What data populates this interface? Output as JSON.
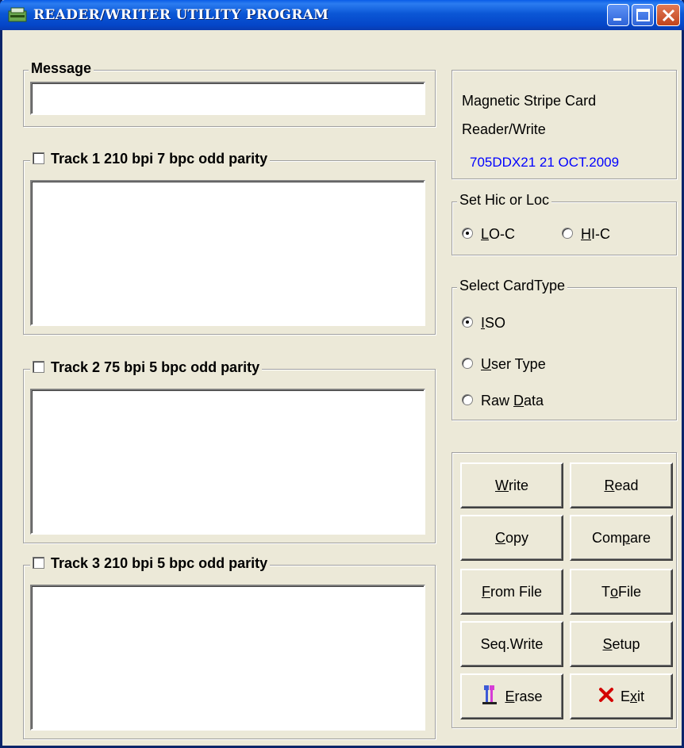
{
  "window": {
    "title": "READER/WRITER UTILITY PROGRAM",
    "icon": "card-reader-icon"
  },
  "message": {
    "label": "Message",
    "value": ""
  },
  "tracks": [
    {
      "label": "Track 1 210 bpi 7 bpc odd parity",
      "checked": false,
      "value": ""
    },
    {
      "label": "Track 2 75  bpi 5 bpc odd parity",
      "checked": false,
      "value": ""
    },
    {
      "label": "Track 3 210 bpi 5 bpc odd parity",
      "checked": false,
      "value": ""
    }
  ],
  "info": {
    "line1": "Magnetic Stripe Card",
    "line2": "Reader/Write",
    "version": "705DDX21 21 OCT.2009",
    "version_color": "#0000ff"
  },
  "coercivity": {
    "label": "Set Hic or Loc",
    "options": [
      {
        "pre": "",
        "key": "L",
        "post": "O-C",
        "selected": true
      },
      {
        "pre": "",
        "key": "H",
        "post": "I-C",
        "selected": false
      }
    ]
  },
  "card_type": {
    "label": "Select CardType",
    "options": [
      {
        "pre": "",
        "key": "I",
        "post": "SO",
        "selected": true
      },
      {
        "pre": "",
        "key": "U",
        "post": "ser Type",
        "selected": false
      },
      {
        "pre": "Raw ",
        "key": "D",
        "post": "ata",
        "selected": false
      }
    ]
  },
  "buttons": {
    "write": {
      "pre": "",
      "key": "W",
      "post": "rite"
    },
    "read": {
      "pre": "",
      "key": "R",
      "post": "ead"
    },
    "copy": {
      "pre": "",
      "key": "C",
      "post": "opy"
    },
    "compare": {
      "pre": "Com",
      "key": "p",
      "post": "are"
    },
    "from_file": {
      "pre": "",
      "key": "F",
      "post": "rom File"
    },
    "to_file": {
      "pre": "T",
      "key": "o",
      "post": " File"
    },
    "seq_write": {
      "pre": "Seq.Write",
      "key": "",
      "post": ""
    },
    "setup": {
      "pre": "",
      "key": "S",
      "post": "etup"
    },
    "erase": {
      "pre": "",
      "key": "E",
      "post": "rase",
      "icon": "eraser-icon"
    },
    "exit": {
      "pre": "E",
      "key": "x",
      "post": "it",
      "icon": "red-x-icon"
    }
  }
}
